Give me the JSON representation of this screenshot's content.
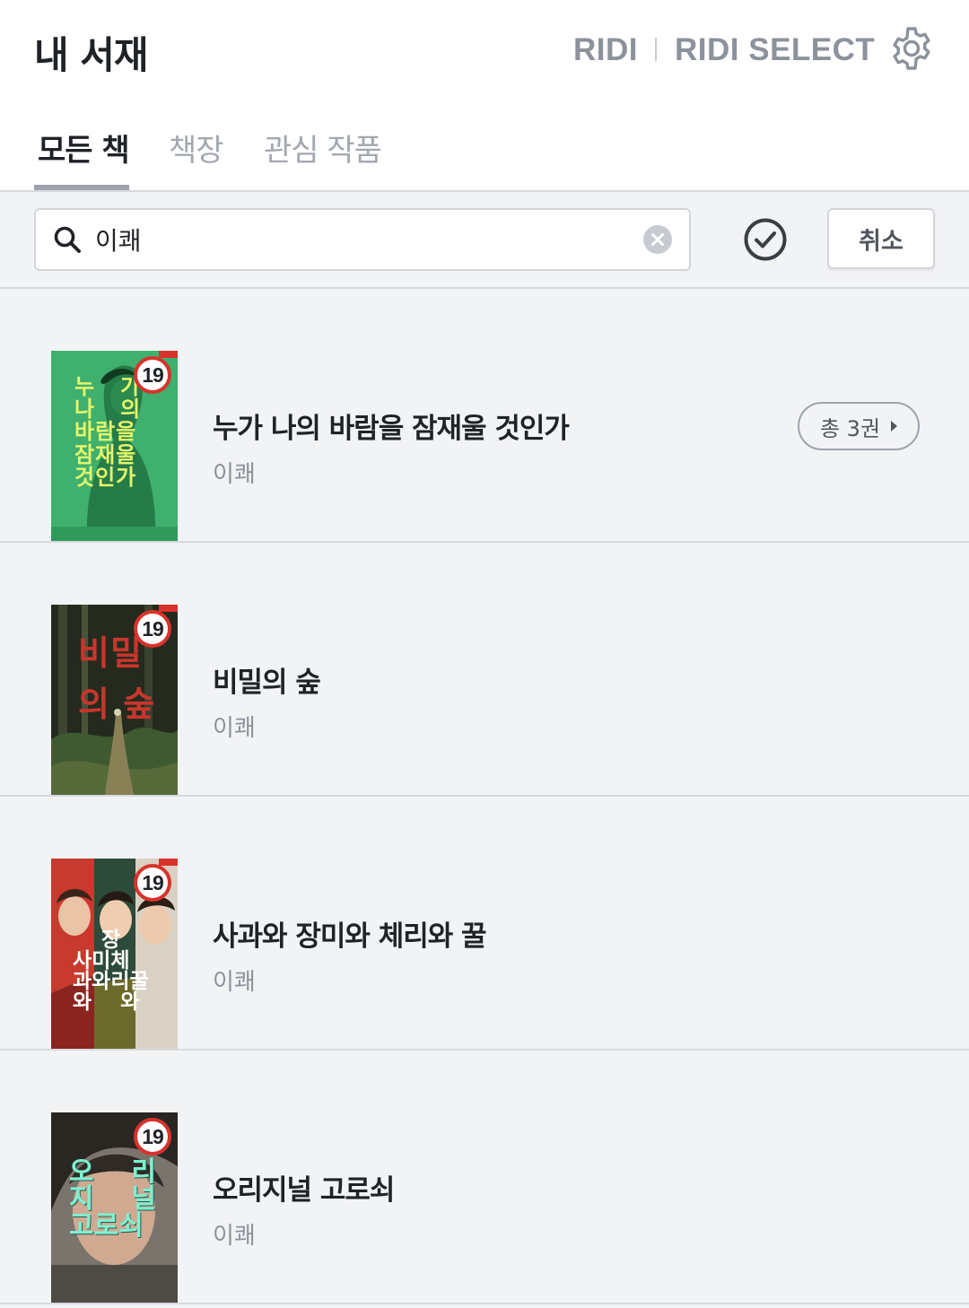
{
  "header": {
    "title": "내 서재",
    "brand_ridi": "RIDI",
    "brand_select": "RIDI SELECT",
    "settings_icon": "gear-icon"
  },
  "tabs": [
    {
      "label": "모든 책",
      "active": true
    },
    {
      "label": "책장",
      "active": false
    },
    {
      "label": "관심 작품",
      "active": false
    }
  ],
  "search": {
    "value": "이쾌",
    "placeholder": "",
    "cancel_label": "취소"
  },
  "books": [
    {
      "title": "누가 나의 바람을 잠재울 것인가",
      "author": "이쾌",
      "badge": "19",
      "series_label": "총 3권",
      "cover_color": "#3fb06e"
    },
    {
      "title": "비밀의 숲",
      "author": "이쾌",
      "badge": "19",
      "cover_color": "#2a2f22"
    },
    {
      "title": "사과와 장미와 체리와 꿀",
      "author": "이쾌",
      "badge": "19",
      "cover_color": "#b8322a"
    },
    {
      "title": "오리지널 고로쇠",
      "author": "이쾌",
      "badge": "19",
      "cover_color": "#6a6660"
    }
  ],
  "colors": {
    "background": "#f2f3f5",
    "header_bg": "#ffffff",
    "text_primary": "#1f2226",
    "text_muted": "#8c929b",
    "badge_ring": "#d8322c"
  }
}
